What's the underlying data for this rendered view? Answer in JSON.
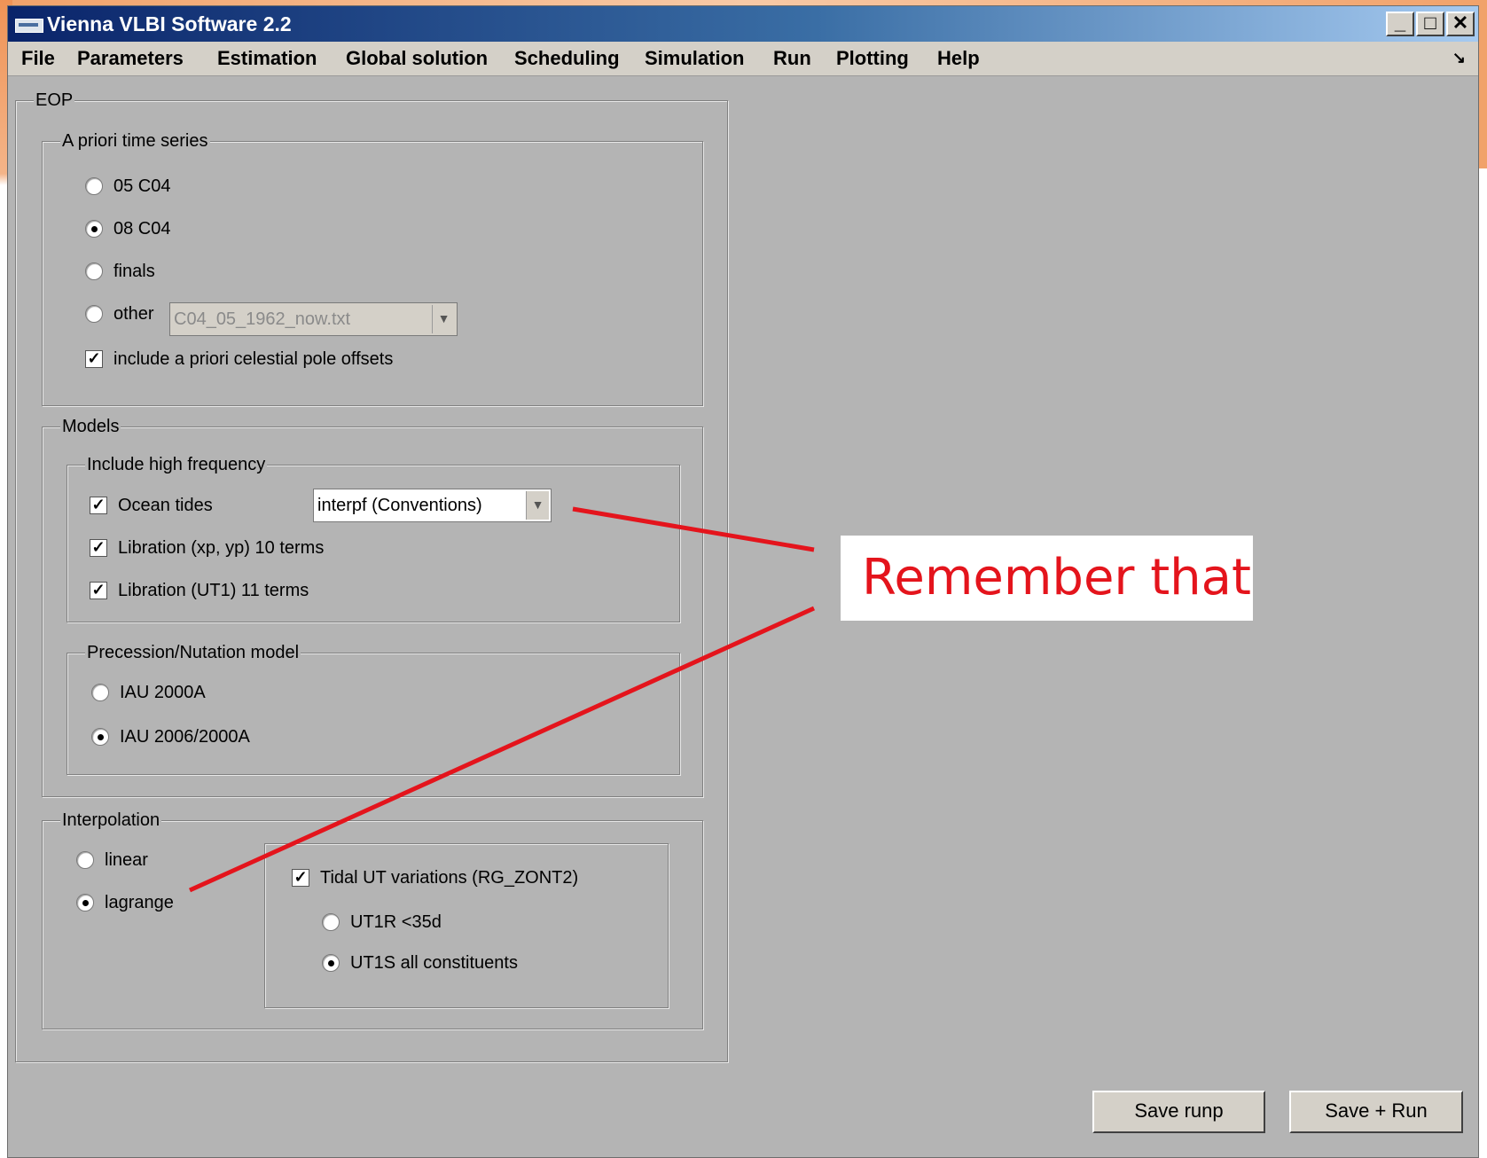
{
  "window": {
    "title": "Vienna VLBI Software 2.2",
    "controls": {
      "minimize": "_",
      "maximize": "□",
      "close": "✕"
    }
  },
  "menu": [
    "File",
    "Parameters",
    "Estimation",
    "Global solution",
    "Scheduling",
    "Simulation",
    "Run",
    "Plotting",
    "Help"
  ],
  "menu_corner_arrow": "↘",
  "eop": {
    "legend": "EOP",
    "apriori": {
      "legend": "A priori time series",
      "options": [
        "05 C04",
        "08 C04",
        "finals",
        "other"
      ],
      "selected": "08 C04",
      "other_file": "C04_05_1962_now.txt",
      "celestial_offsets_label": "include a priori celestial pole offsets",
      "celestial_offsets_checked": true
    },
    "models": {
      "legend": "Models",
      "high_frequency": {
        "legend": "Include high frequency",
        "ocean_tides_label": "Ocean tides",
        "ocean_tides_checked": true,
        "ocean_tides_model": "interpf (Conventions)",
        "libration_xp_label": "Libration (xp, yp) 10 terms",
        "libration_xp_checked": true,
        "libration_ut1_label": "Libration (UT1) 11 terms",
        "libration_ut1_checked": true
      },
      "precession": {
        "legend": "Precession/Nutation model",
        "options": [
          "IAU 2000A",
          "IAU 2006/2000A"
        ],
        "selected": "IAU 2006/2000A"
      }
    },
    "interpolation": {
      "legend": "Interpolation",
      "options": [
        "linear",
        "lagrange"
      ],
      "selected": "lagrange",
      "tidal_ut_label": "Tidal UT variations (RG_ZONT2)",
      "tidal_ut_checked": true,
      "tidal_options": [
        "UT1R <35d",
        "UT1S all constituents"
      ],
      "tidal_selected": "UT1S all constituents"
    }
  },
  "buttons": {
    "save_runp": "Save runp",
    "save_run": "Save + Run"
  },
  "annotation": {
    "text": "Remember that",
    "color": "#e4141c"
  }
}
